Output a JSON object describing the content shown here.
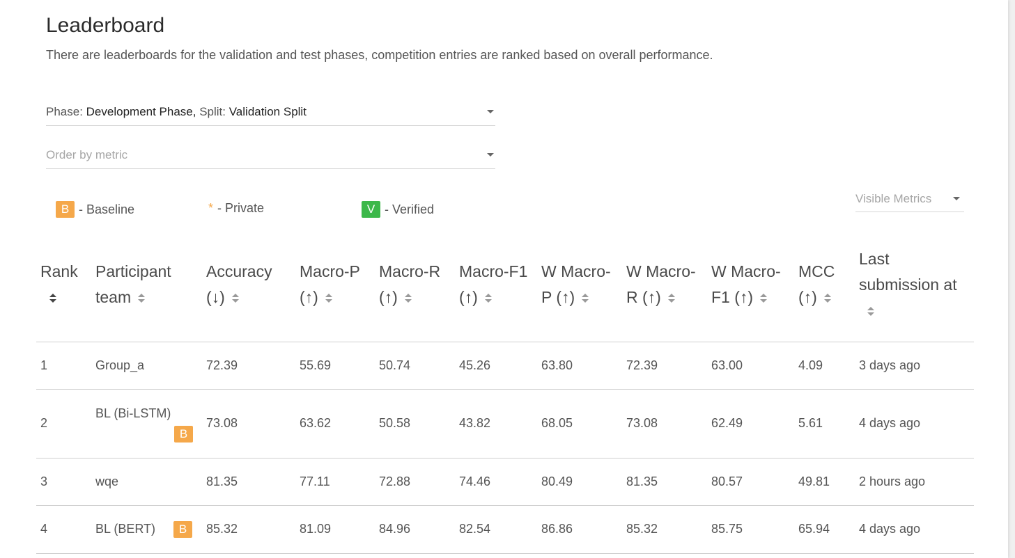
{
  "title": "Leaderboard",
  "subtitle": "There are leaderboards for the validation and test phases, competition entries are ranked based on overall performance.",
  "phase_select": {
    "phase_label": "Phase: ",
    "phase_value": "Development Phase,",
    "split_label": " Split: ",
    "split_value": "Validation Split"
  },
  "order_select": {
    "placeholder": "Order by metric"
  },
  "legend": {
    "baseline_badge": "B",
    "baseline_label": "- Baseline",
    "private_mark": "*",
    "private_label": "- Private",
    "verified_badge": "V",
    "verified_label": "- Verified"
  },
  "visible_metrics": {
    "placeholder": "Visible Metrics"
  },
  "colors": {
    "baseline": "#f5a84a",
    "verified": "#3cb84a",
    "text": "#4a4a4a"
  },
  "table": {
    "headers": [
      {
        "line1": "Rank",
        "line2": ""
      },
      {
        "line1": "Participant",
        "line2": "team"
      },
      {
        "line1": "Accuracy",
        "line2": "(↓)"
      },
      {
        "line1": "Macro-P",
        "line2": "(↑)"
      },
      {
        "line1": "Macro-R",
        "line2": "(↑)"
      },
      {
        "line1": "Macro-F1",
        "line2": "(↑)"
      },
      {
        "line1": "W Macro-",
        "line2": "P (↑)"
      },
      {
        "line1": "W Macro-",
        "line2": "R (↑)"
      },
      {
        "line1": "W Macro-",
        "line2": "F1 (↑)"
      },
      {
        "line1": "MCC",
        "line2": "(↑)"
      },
      {
        "line1": "Last",
        "line2": "submission at"
      }
    ],
    "rows": [
      {
        "rank": "1",
        "team": "Group_a",
        "baseline": false,
        "accuracy": "72.39",
        "macro_p": "55.69",
        "macro_r": "50.74",
        "macro_f1": "45.26",
        "w_macro_p": "63.80",
        "w_macro_r": "72.39",
        "w_macro_f1": "63.00",
        "mcc": "4.09",
        "last": "3 days ago"
      },
      {
        "rank": "2",
        "team": "BL (Bi-LSTM)",
        "baseline": true,
        "accuracy": "73.08",
        "macro_p": "63.62",
        "macro_r": "50.58",
        "macro_f1": "43.82",
        "w_macro_p": "68.05",
        "w_macro_r": "73.08",
        "w_macro_f1": "62.49",
        "mcc": "5.61",
        "last": "4 days ago"
      },
      {
        "rank": "3",
        "team": "wqe",
        "baseline": false,
        "accuracy": "81.35",
        "macro_p": "77.11",
        "macro_r": "72.88",
        "macro_f1": "74.46",
        "w_macro_p": "80.49",
        "w_macro_r": "81.35",
        "w_macro_f1": "80.57",
        "mcc": "49.81",
        "last": "2 hours ago"
      },
      {
        "rank": "4",
        "team": "BL (BERT)",
        "baseline": true,
        "accuracy": "85.32",
        "macro_p": "81.09",
        "macro_r": "84.96",
        "macro_f1": "82.54",
        "w_macro_p": "86.86",
        "w_macro_r": "85.32",
        "w_macro_f1": "85.75",
        "mcc": "65.94",
        "last": "4 days ago"
      }
    ]
  }
}
